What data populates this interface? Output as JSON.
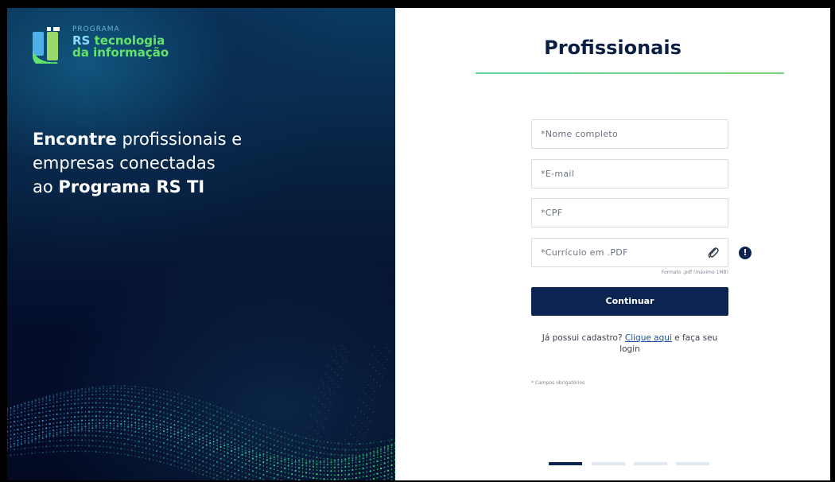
{
  "brand": {
    "logo_small": "PROGRAMA",
    "logo_line1_rs": "RS",
    "logo_line1_rest": "tecnologia",
    "logo_line2": "da informação",
    "accent_green": "#63e36b",
    "accent_blue": "#8fd9ff"
  },
  "hero": {
    "part1_bold": "Encontre",
    "part1_rest": " profissionais e",
    "part2": "empresas conectadas",
    "part3_prefix": "ao ",
    "part3_bold": "Programa RS TI"
  },
  "form": {
    "title": "Profissionais",
    "fields": [
      {
        "placeholder": "*Nome completo"
      },
      {
        "placeholder": "*E-mail"
      },
      {
        "placeholder": "*CPF"
      },
      {
        "placeholder": "*Currículo em .PDF"
      }
    ],
    "file_hint": "Formato .pdf (máximo 1MB)",
    "info_icon": "!",
    "submit_label": "Continuar",
    "login_prefix": "Já possui cadastro? ",
    "login_link": "Clique aqui",
    "login_suffix": " e faça seu login",
    "required_note": "* Campos obrigatórios"
  },
  "progress": {
    "total_steps": 4,
    "current_step": 1
  },
  "colors": {
    "primary": "#0b2451",
    "divider": "#63d6a0",
    "inactive_step": "#e2e8f2"
  }
}
